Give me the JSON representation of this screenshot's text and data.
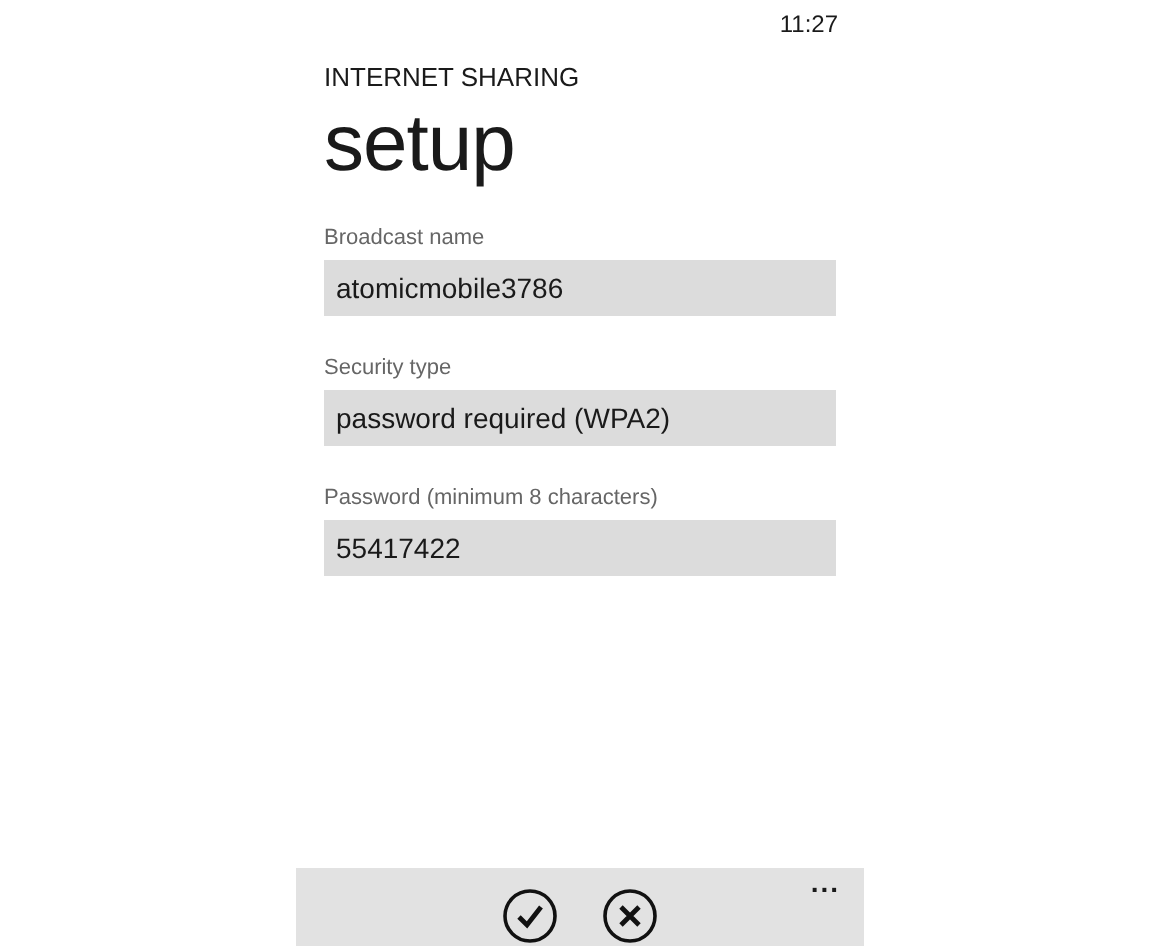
{
  "status_bar": {
    "time": "11:27"
  },
  "header": {
    "app_title": "INTERNET SHARING",
    "page_title": "setup"
  },
  "fields": [
    {
      "label": "Broadcast name",
      "value": "atomicmobile3786"
    },
    {
      "label": "Security type",
      "value": "password required (WPA2)"
    },
    {
      "label": "Password (minimum 8 characters)",
      "value": "55417422"
    }
  ],
  "app_bar": {
    "more": "..."
  }
}
